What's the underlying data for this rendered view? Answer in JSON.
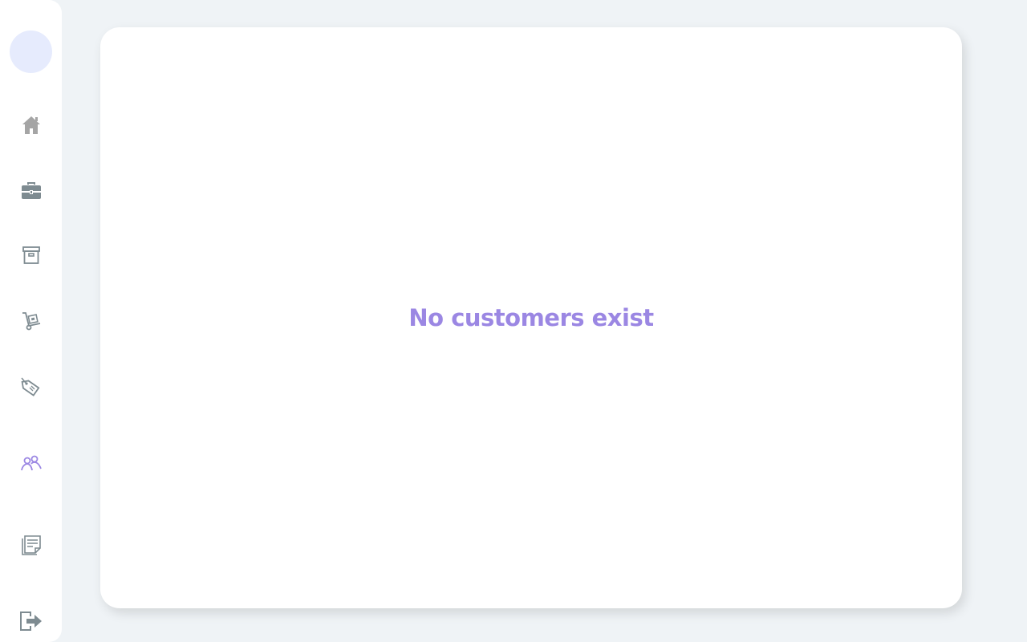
{
  "sidebar": {
    "items": [
      {
        "icon": "home-icon",
        "color": "#a5a5a5"
      },
      {
        "icon": "briefcase-icon",
        "color": "#7e8b91"
      },
      {
        "icon": "archive-box-icon",
        "color": "#7e8b91"
      },
      {
        "icon": "hand-truck-icon",
        "color": "#7e8b91"
      },
      {
        "icon": "price-tag-icon",
        "color": "#7e8b91"
      },
      {
        "icon": "customers-icon",
        "color": "#9b87e3",
        "active": true
      },
      {
        "icon": "notes-icon",
        "color": "#7e8b91"
      },
      {
        "icon": "logout-icon",
        "color": "#7e8b91"
      }
    ]
  },
  "main": {
    "empty_message": "No customers exist"
  },
  "colors": {
    "background": "#eff3f6",
    "accent": "#9b87e3",
    "avatar": "#e6ebfd"
  }
}
